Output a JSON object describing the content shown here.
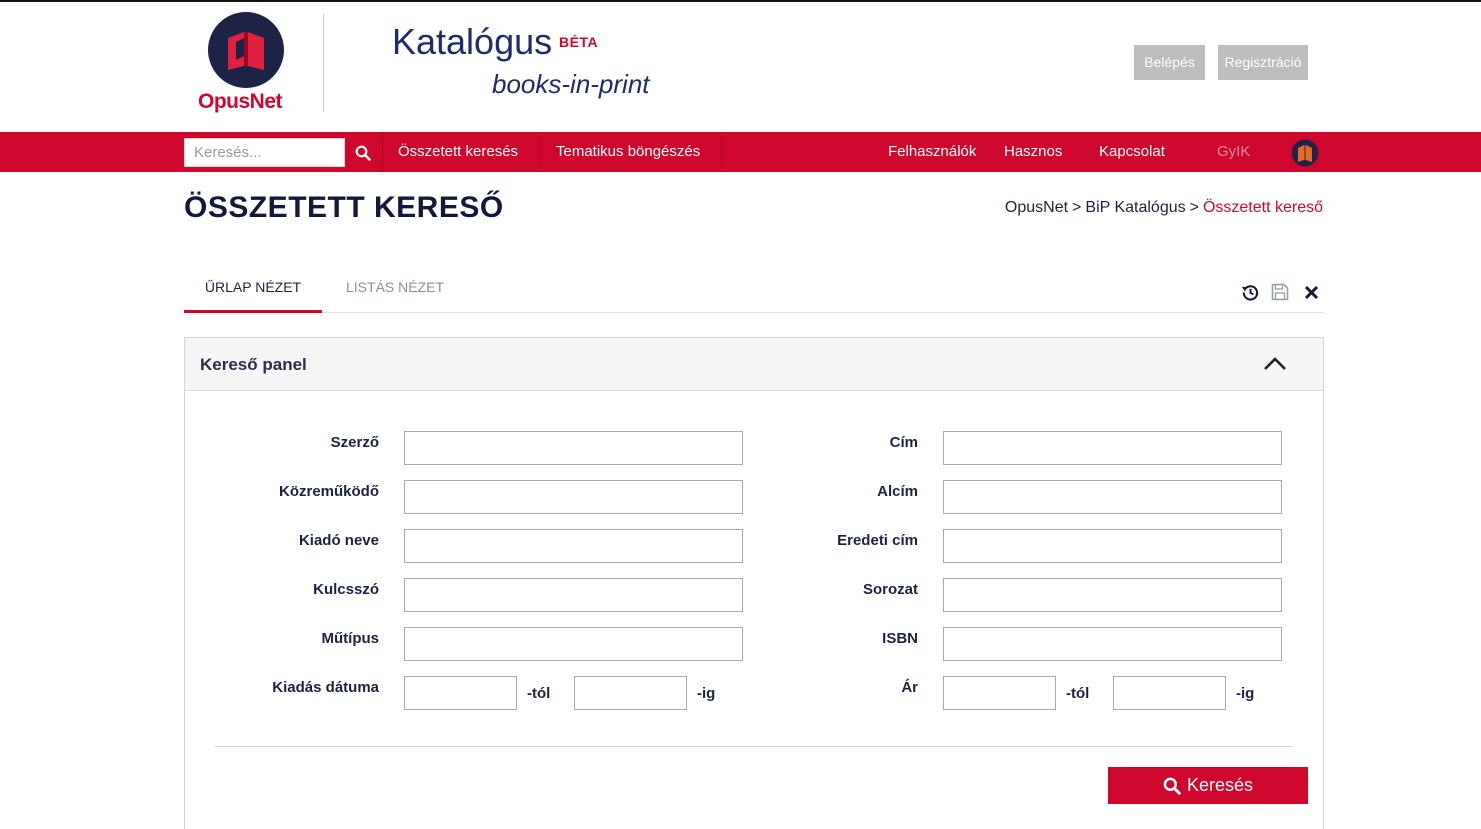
{
  "header": {
    "logo_text": "OpusNet",
    "catalog_title": "Katalógus",
    "beta_badge": "BÉTA",
    "subtitle": "books-in-print",
    "login_label": "Belépés",
    "register_label": "Regisztráció"
  },
  "nav": {
    "search_placeholder": "Keresés...",
    "advanced_search": "Összetett keresés",
    "thematic_browse": "Tematikus böngészés",
    "users": "Felhasználók",
    "useful": "Hasznos",
    "contact": "Kapcsolat",
    "faq": "GyIK"
  },
  "page": {
    "title": "ÖSSZETETT KERESŐ",
    "breadcrumb": [
      "OpusNet",
      "BiP Katalógus",
      "Összetett kereső"
    ],
    "breadcrumb_separator": ">"
  },
  "tabs": {
    "form_view": "ŰRLAP NÉZET",
    "list_view": "LISTÁS NÉZET"
  },
  "panel": {
    "title": "Kereső panel",
    "left_fields": [
      "Szerző",
      "Közreműködő",
      "Kiadó neve",
      "Kulcsszó",
      "Műtípus",
      "Kiadás dátuma"
    ],
    "right_fields": [
      "Cím",
      "Alcím",
      "Eredeti cím",
      "Sorozat",
      "ISBN",
      "Ár"
    ],
    "range_from": "-tól",
    "range_to": "-ig",
    "search_button": "Keresés"
  },
  "colors": {
    "brand_red": "#d0072d",
    "navy": "#1d2347",
    "header_button_gray": "#bdbdbd"
  }
}
